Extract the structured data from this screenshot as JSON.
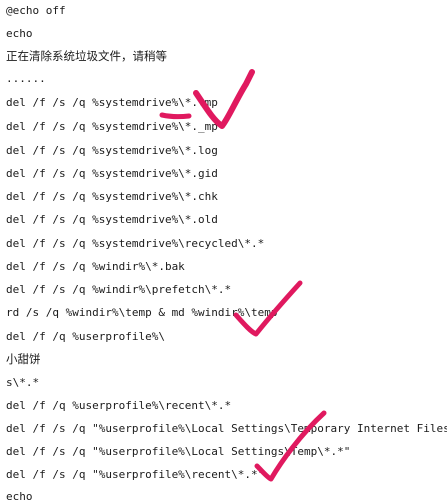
{
  "script_lines": [
    "@echo off",
    "echo",
    "正在清除系统垃圾文件，请稍等",
    "......",
    "del /f /s /q %systemdrive%\\*.tmp",
    "del /f /s /q %systemdrive%\\*._mp",
    "del /f /s /q %systemdrive%\\*.log",
    "del /f /s /q %systemdrive%\\*.gid",
    "del /f /s /q %systemdrive%\\*.chk",
    "del /f /s /q %systemdrive%\\*.old",
    "del /f /s /q %systemdrive%\\recycled\\*.*",
    "del /f /s /q %windir%\\*.bak",
    "del /f /s /q %windir%\\prefetch\\*.*",
    "rd /s /q %windir%\\temp & md %windir%\\temp",
    "del /f /q %userprofile%\\",
    "小甜饼",
    "s\\*.*",
    "del /f /q %userprofile%\\recent\\*.*",
    "del /f /s /q \"%userprofile%\\Local Settings\\Temporary Internet Files\\*.*\"",
    "del /f /s /q \"%userprofile%\\Local Settings\\Temp\\*.*\"",
    "del /f /s /q \"%userprofile%\\recent\\*.*\"",
    "echo"
  ],
  "annotation_color": "#e0195f",
  "annotations": [
    "checkmark-1",
    "underline",
    "checkmark-2",
    "checkmark-3"
  ]
}
